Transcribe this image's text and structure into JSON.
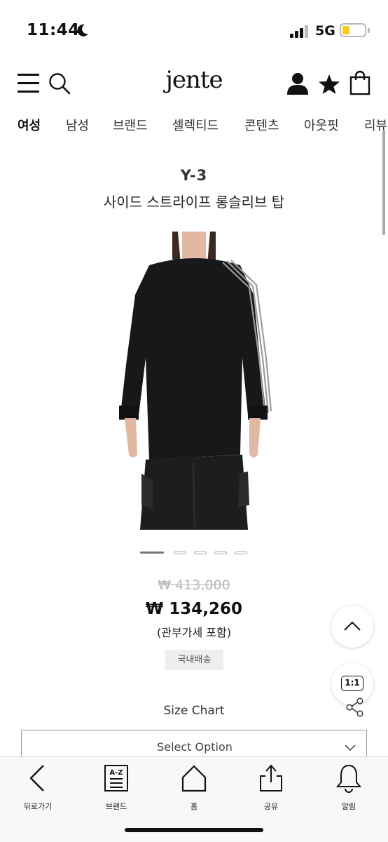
{
  "status_bar": {
    "time": "11:44",
    "network": "5G",
    "icons": [
      "moon-icon",
      "signal-icon",
      "battery-icon"
    ]
  },
  "header": {
    "logo": "jente",
    "icons": [
      "menu-icon",
      "search-icon",
      "user-icon",
      "star-icon",
      "bag-icon"
    ]
  },
  "categories": [
    "여성",
    "남성",
    "브랜드",
    "셀렉티드",
    "콘텐츠",
    "아웃핏",
    "리뷰"
  ],
  "active_category": "여성",
  "product": {
    "brand": "Y-3",
    "name": "사이드 스트라이프 롱슬리브 탑",
    "image_count": 5,
    "active_image": 1,
    "price_original": "₩ 413,000",
    "price_sale": "₩ 134,260",
    "price_note": "(관부가세 포함)",
    "shipping_badge": "국내배송"
  },
  "floating": {
    "chat_label": "1:1"
  },
  "options": {
    "size_chart": "Size Chart",
    "select_placeholder": "Select Option"
  },
  "toolbar": [
    {
      "label": "뒤로가기",
      "icon": "back-arrow-icon"
    },
    {
      "label": "브랜드",
      "icon": "a-z-brand-icon"
    },
    {
      "label": "홈",
      "icon": "home-icon"
    },
    {
      "label": "공유",
      "icon": "share-upload-icon"
    },
    {
      "label": "알림",
      "icon": "bell-icon"
    }
  ],
  "colors": {
    "sale_price": "#111111",
    "original_price": "#b6b6b6",
    "battery": "#f4cd1e",
    "badge_bg": "#eeeeee"
  }
}
